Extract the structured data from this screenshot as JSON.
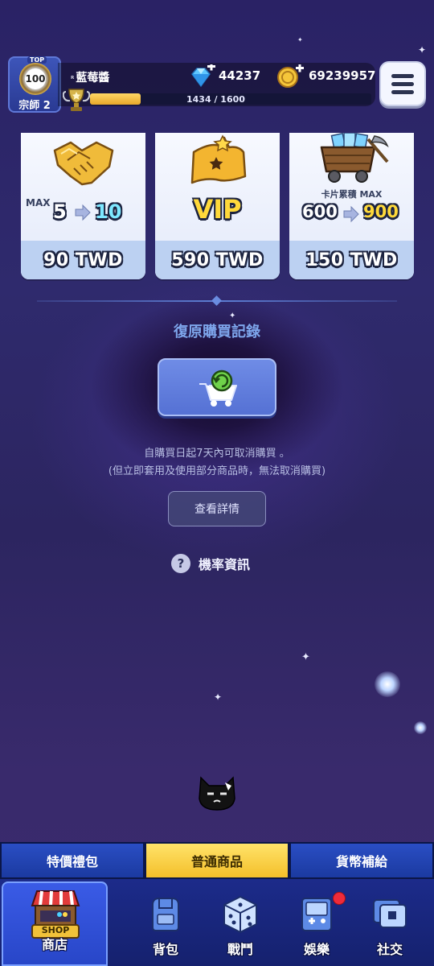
{
  "player": {
    "rank_top_tag": "TOP",
    "rank_number": "100",
    "rank_title": "宗師 2",
    "name_prefix": "ᴿ",
    "name": "藍莓醬",
    "xp_current": 1434,
    "xp_max": 1600,
    "xp_text": "1434 / 1600",
    "gems": "44237",
    "coins": "69239957"
  },
  "shop_cards": [
    {
      "icon": "handshake-icon",
      "line_prefix": "MAX",
      "from": "5",
      "to": "10",
      "price": "90 TWD"
    },
    {
      "icon": "vip-ticket-icon",
      "headline": "VIP",
      "price": "590 TWD"
    },
    {
      "icon": "mine-cart-icon",
      "caption": "卡片累積 MAX",
      "from": "600",
      "to": "900",
      "price": "150 TWD"
    }
  ],
  "restore": {
    "title": "復原購買記錄",
    "notice_line1": "自購買日起7天內可取消購買 。",
    "notice_line2": "(但立即套用及使用部分商品時，無法取消購買)",
    "details_button": "查看詳情",
    "probability_label": "機率資訊",
    "probability_icon": "?"
  },
  "tabs": [
    {
      "label": "特價禮包",
      "active": false
    },
    {
      "label": "普通商品",
      "active": true
    },
    {
      "label": "貨幣補給",
      "active": false
    }
  ],
  "bottom_nav": {
    "shop_sign": "SHOP",
    "items": [
      {
        "label": "商店",
        "icon": "shop-icon"
      },
      {
        "label": "背包",
        "icon": "backpack-icon"
      },
      {
        "label": "戰鬥",
        "icon": "dice-icon"
      },
      {
        "label": "娛樂",
        "icon": "arcade-icon"
      },
      {
        "label": "社交",
        "icon": "social-icon"
      }
    ]
  },
  "colors": {
    "accent_blue": "#5571d4",
    "tab_active": "#f4bf2a",
    "price_strip": "#bcd1f2",
    "title_blue": "#7ea6ec"
  }
}
